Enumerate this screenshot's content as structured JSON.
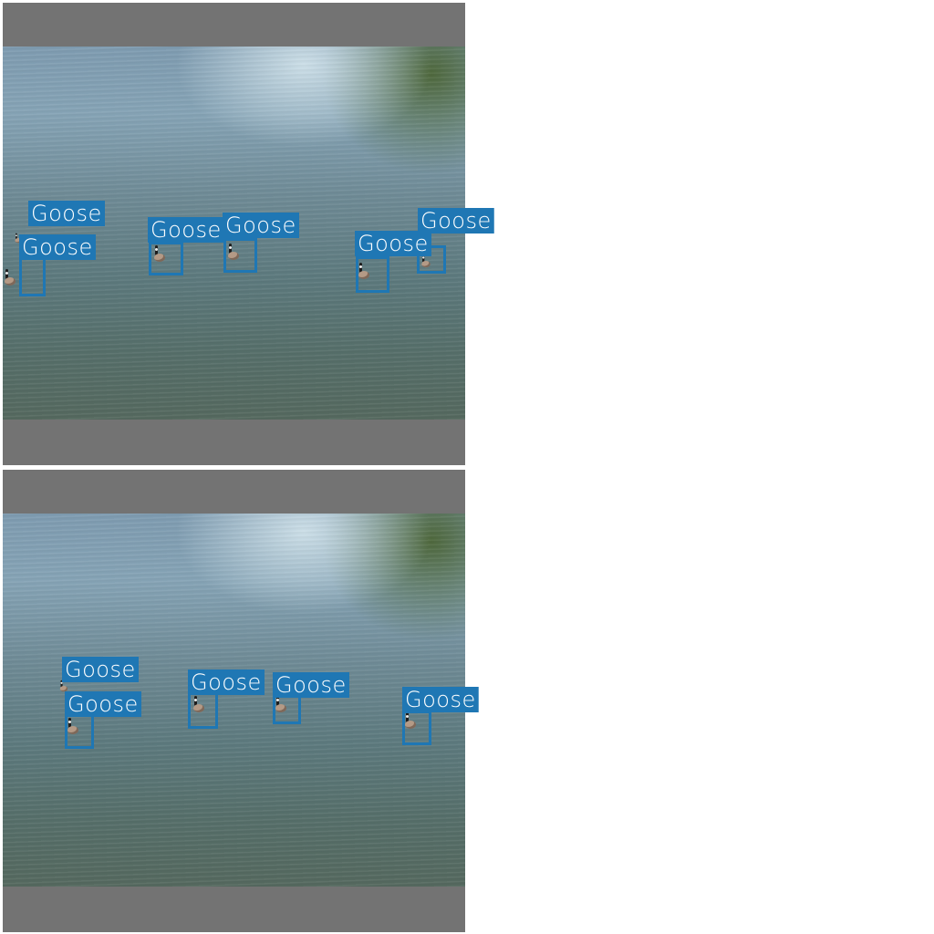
{
  "top_panel": {
    "labels": [
      "Goose",
      "Goose",
      "Goose",
      "Goose",
      "Goose",
      "Goose"
    ]
  },
  "bottom_panel": {
    "labels": [
      "Goose",
      "Goose",
      "Goose",
      "Goose",
      "Goose"
    ]
  },
  "colors": {
    "box": "#1f77b4",
    "label_text": "#ffffff",
    "letterbox": "#737373",
    "background": "#ffffff"
  }
}
